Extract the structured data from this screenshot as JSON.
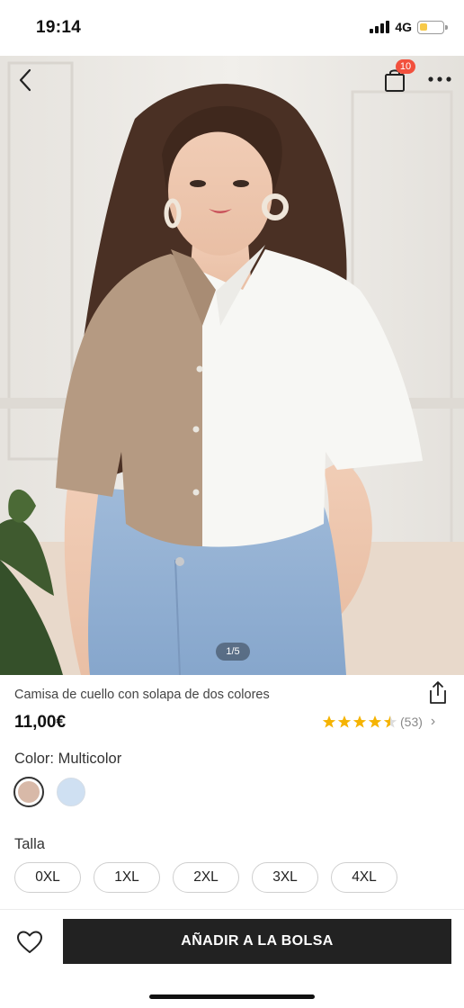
{
  "status_bar": {
    "time": "19:14",
    "network": "4G",
    "battery_level": 0.35
  },
  "header": {
    "bag_count": "10"
  },
  "gallery": {
    "pager": "1/5"
  },
  "product": {
    "title": "Camisa de cuello con solapa de dos colores",
    "price": "11,00€",
    "rating": {
      "stars": 4.5,
      "count": "(53)"
    }
  },
  "color": {
    "label": "Color: Multicolor",
    "swatches": [
      {
        "color": "#d8b9a8",
        "selected": true
      },
      {
        "color": "#cfe0f2",
        "selected": false
      }
    ]
  },
  "size": {
    "label": "Talla",
    "options": [
      "0XL",
      "1XL",
      "2XL",
      "3XL",
      "4XL"
    ]
  },
  "actions": {
    "add_to_bag": "AÑADIR A LA BOLSA"
  },
  "colors": {
    "badge": "#f2503d",
    "star": "#f5b301",
    "cta": "#222222"
  },
  "icons": [
    "back-arrow-icon",
    "shopping-bag-icon",
    "more-icon",
    "share-icon",
    "star-icon",
    "heart-icon"
  ]
}
